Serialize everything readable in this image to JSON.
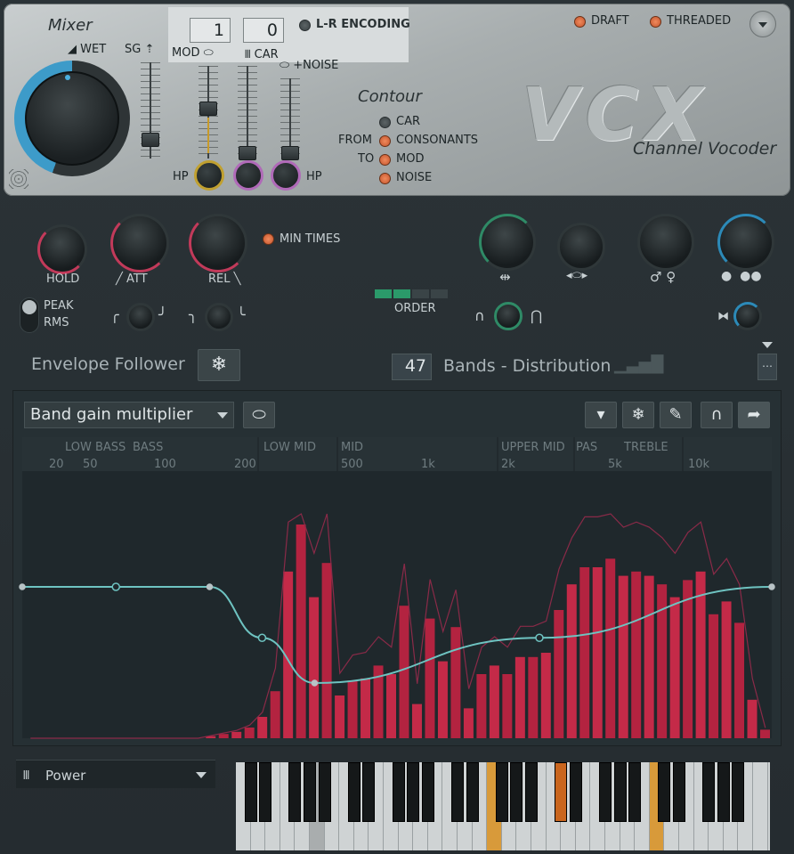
{
  "mixer": {
    "title": "Mixer",
    "wet_label": "WET",
    "sg_label": "SG",
    "mod_label": "MOD",
    "car_label": "CAR",
    "noise_label": "+NOISE",
    "hp_left": "HP",
    "hp_right": "HP",
    "mod_value": "1",
    "car_value": "0",
    "lr_encoding": "L-R ENCODING"
  },
  "contour": {
    "title": "Contour",
    "from": "FROM",
    "to": "TO",
    "options": [
      "CAR",
      "CONSONANTS",
      "MOD",
      "NOISE"
    ]
  },
  "header": {
    "draft": "DRAFT",
    "threaded": "THREADED",
    "logo": "VCX",
    "subtitle": "Channel Vocoder"
  },
  "envelope": {
    "hold": "HOLD",
    "att": "ATT",
    "rel": "REL",
    "min_times": "MIN TIMES",
    "peak": "PEAK",
    "rms": "RMS",
    "title": "Envelope Follower"
  },
  "bands": {
    "order_label": "ORDER",
    "count": "47",
    "title": "Bands - Distribution"
  },
  "graph": {
    "preset": "Band gain multiplier",
    "regions": [
      "LOW BASS",
      "BASS",
      "LOW MID",
      "MID",
      "UPPER MID",
      "PAS",
      "TREBLE"
    ],
    "freqs": [
      "20",
      "50",
      "100",
      "200",
      "500",
      "1k",
      "2k",
      "5k",
      "10k"
    ]
  },
  "chart_data": {
    "type": "bar",
    "values": [
      0,
      0,
      0,
      0,
      0,
      0,
      0,
      0,
      0,
      0,
      0,
      0,
      0,
      0,
      0.01,
      0.02,
      0.03,
      0.05,
      0.1,
      0.22,
      0.78,
      1.0,
      0.66,
      0.82,
      0.2,
      0.27,
      0.28,
      0.34,
      0.3,
      0.62,
      0.16,
      0.56,
      0.36,
      0.52,
      0.14,
      0.3,
      0.34,
      0.3,
      0.38,
      0.38,
      0.4,
      0.6,
      0.72,
      0.8,
      0.8,
      0.84,
      0.76,
      0.78,
      0.76,
      0.72,
      0.66,
      0.74,
      0.78,
      0.58,
      0.64,
      0.54,
      0.18,
      0.04
    ],
    "curve_points": [
      [
        0.0,
        1.0
      ],
      [
        0.125,
        1.0
      ],
      [
        0.25,
        1.0
      ],
      [
        0.32,
        0.47
      ],
      [
        0.39,
        0.0
      ],
      [
        0.69,
        0.47
      ],
      [
        1.0,
        1.0
      ]
    ]
  },
  "bottom": {
    "power": "Power"
  },
  "icons": {
    "knob": "knob-icon",
    "freeze": "snowflake-icon",
    "lips": "lips-icon",
    "magnet": "magnet-icon",
    "arrow": "arrow-icon",
    "piano": "piano-icon"
  }
}
